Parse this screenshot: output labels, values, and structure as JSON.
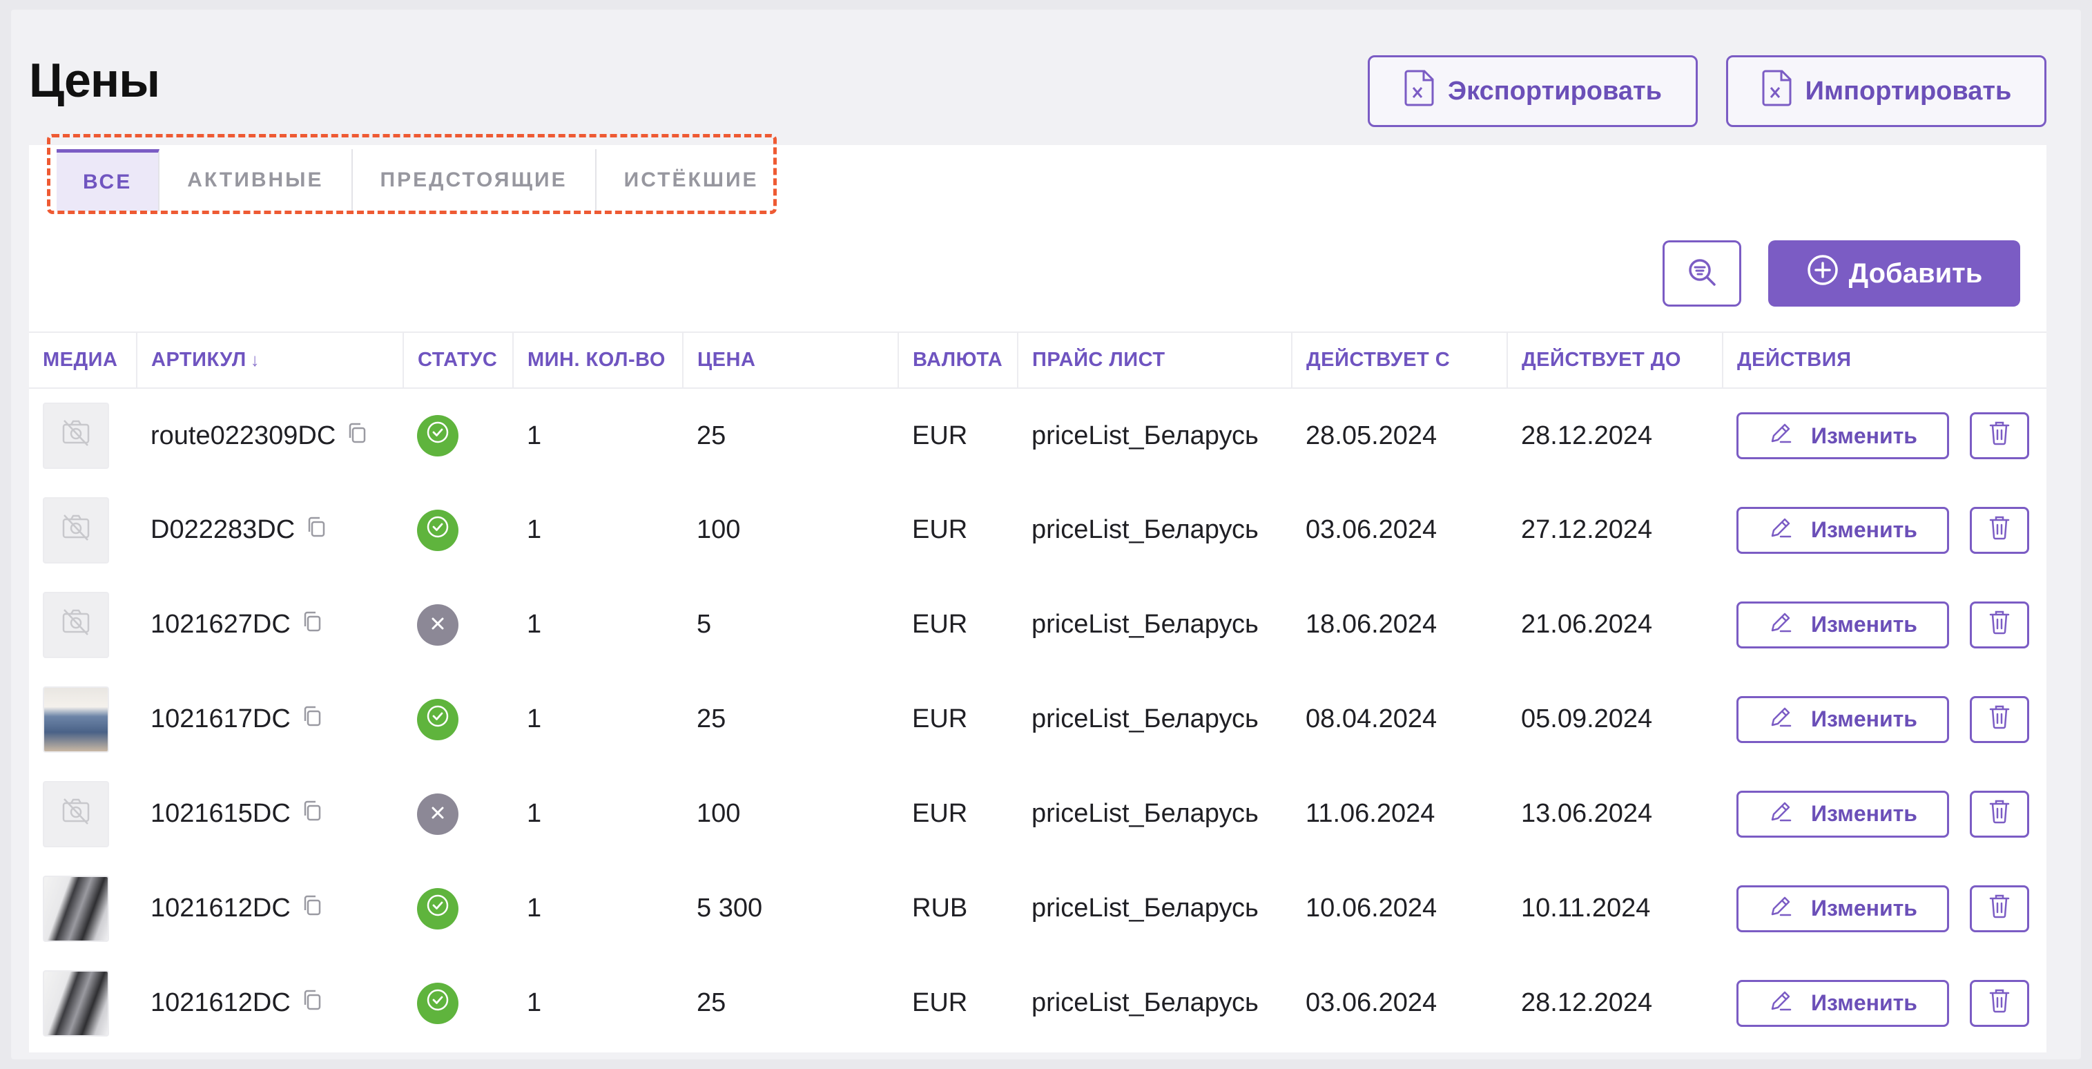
{
  "page": {
    "title": "Цены"
  },
  "toolbar": {
    "export_label": "Экспортировать",
    "import_label": "Импортировать",
    "add_label": "Добавить",
    "filter_icon": "search-filter-icon"
  },
  "tabs": [
    {
      "label": "ВСЕ",
      "active": true
    },
    {
      "label": "АКТИВНЫЕ",
      "active": false
    },
    {
      "label": "ПРЕДСТОЯЩИЕ",
      "active": false
    },
    {
      "label": "ИСТЁКШИЕ",
      "active": false
    }
  ],
  "table": {
    "columns": [
      "МЕДИА",
      "АРТИКУЛ",
      "СТАТУС",
      "МИН. КОЛ-ВО",
      "ЦЕНА",
      "ВАЛЮТА",
      "ПРАЙС ЛИСТ",
      "ДЕЙСТВУЕТ С",
      "ДЕЙСТВУЕТ ДО",
      "ДЕЙСТВИЯ"
    ],
    "sort_indicator": "↓",
    "edit_label": "Изменить",
    "rows": [
      {
        "media": "placeholder",
        "sku": "route022309DC",
        "status": "active",
        "min_qty": "1",
        "price": "25",
        "currency": "EUR",
        "price_list": "priceList_Беларусь",
        "from": "28.05.2024",
        "to": "28.12.2024"
      },
      {
        "media": "placeholder",
        "sku": "D022283DC",
        "status": "active",
        "min_qty": "1",
        "price": "100",
        "currency": "EUR",
        "price_list": "priceList_Беларусь",
        "from": "03.06.2024",
        "to": "27.12.2024"
      },
      {
        "media": "placeholder",
        "sku": "1021627DC",
        "status": "inactive",
        "min_qty": "1",
        "price": "5",
        "currency": "EUR",
        "price_list": "priceList_Беларусь",
        "from": "18.06.2024",
        "to": "21.06.2024"
      },
      {
        "media": "photo-jeans",
        "sku": "1021617DC",
        "status": "active",
        "min_qty": "1",
        "price": "25",
        "currency": "EUR",
        "price_list": "priceList_Беларусь",
        "from": "08.04.2024",
        "to": "05.09.2024"
      },
      {
        "media": "placeholder",
        "sku": "1021615DC",
        "status": "inactive",
        "min_qty": "1",
        "price": "100",
        "currency": "EUR",
        "price_list": "priceList_Беларусь",
        "from": "11.06.2024",
        "to": "13.06.2024"
      },
      {
        "media": "photo-phone",
        "sku": "1021612DC",
        "status": "active",
        "min_qty": "1",
        "price": "5 300",
        "currency": "RUB",
        "price_list": "priceList_Беларусь",
        "from": "10.06.2024",
        "to": "10.11.2024"
      },
      {
        "media": "photo-phone",
        "sku": "1021612DC",
        "status": "active",
        "min_qty": "1",
        "price": "25",
        "currency": "EUR",
        "price_list": "priceList_Беларусь",
        "from": "03.06.2024",
        "to": "28.12.2024"
      }
    ]
  },
  "colors": {
    "accent": "#7b5cc4",
    "status_active": "#5fb43d",
    "status_inactive": "#8c8896",
    "highlight": "#ee5a33"
  }
}
